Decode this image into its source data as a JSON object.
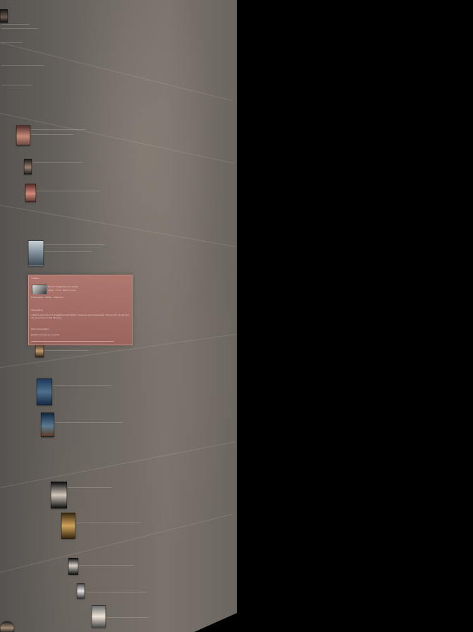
{
  "timeline": {
    "title": "Enlightenment",
    "portrait_count": 14
  },
  "highlight_card": {
    "title": "Voltaire",
    "subtitle": "French Enlightenment writer",
    "meta": "1694 - 1778 · Paris, France",
    "tags": "Philosopher · Writer · Historian",
    "heading": "Description",
    "body": "Voltaire was a French Enlightenment writer, historian and philosopher famous for his wit and his advocacy of civil liberties.",
    "footer": "More information",
    "link": "Related people and events"
  },
  "colors": {
    "background": "#000000",
    "panel": "#6b6660",
    "card": "#b4786e"
  }
}
